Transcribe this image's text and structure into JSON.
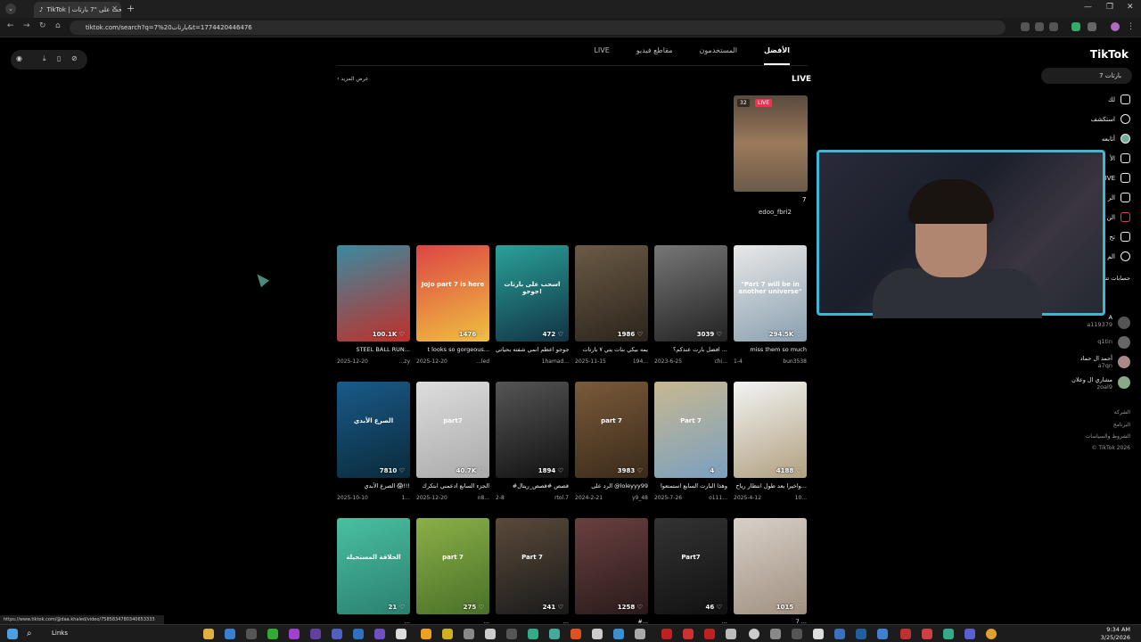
{
  "browser": {
    "tab_title": "TikTok | ابحث على \"7 بارتات\"",
    "url": "tiktok.com/search?q=7%20بارتات&t=1774420446476",
    "status_url": "https://www.tiktok.com/@daa.khaled/video/7585834780340653333"
  },
  "tiktok": {
    "logo": "TikTok",
    "search_value": "7 بارتات",
    "sidebar": [
      {
        "label": "لك",
        "icon": "home-icon"
      },
      {
        "label": "استكشف",
        "icon": "compass-icon"
      },
      {
        "label": "أتابعه",
        "icon": "avatar-icon"
      },
      {
        "label": "الأ",
        "icon": "friends-icon"
      },
      {
        "label": "LIVE",
        "icon": "live-icon"
      },
      {
        "label": "الر",
        "icon": "send-icon"
      },
      {
        "label": "الن",
        "icon": "inbox-icon"
      },
      {
        "label": "تح",
        "icon": "upload-icon"
      },
      {
        "label": "الم",
        "icon": "profile-icon"
      }
    ],
    "suggested_title": "حسابات تتابعها",
    "suggested": [
      {
        "name": "A",
        "handle": "a119379"
      },
      {
        "name": "",
        "handle": "q1tin"
      },
      {
        "name": "أحمد ال حماد",
        "handle": "a7qn"
      },
      {
        "name": "مشاري ال وعلان",
        "handle": "zoal9"
      }
    ],
    "footer": [
      "الشركة",
      "البرنامج",
      "الشروط والسياسات",
      "© TikTok 2026"
    ],
    "tabs": [
      "LIVE",
      "مقاطع فيديو",
      "المستخدمون",
      "الأفضل"
    ],
    "live_section": {
      "title": "LIVE",
      "see_more": "عرض المزيد",
      "badge": "LIVE",
      "viewers": "32",
      "caption": "7",
      "user": "edoo_fbri2"
    },
    "videos": [
      {
        "views": "294.5K",
        "overlay": "\"Part 7 will be in another universe\"",
        "desc": "miss them so much",
        "date": "1-4",
        "user": "bun3538",
        "color1": "#e8e8e8",
        "color2": "#8aa0b0"
      },
      {
        "views": "3039",
        "overlay": "",
        "desc": "افضل بارت عندكم؟ ...",
        "date": "2023-6-25",
        "user": "chi...",
        "color1": "#777",
        "color2": "#222"
      },
      {
        "views": "1986",
        "overlay": "",
        "desc": "يمه بيكي بنات يتي ٧ بارتات",
        "date": "2025-11-15",
        "user": "194...",
        "color1": "#6b5a45",
        "color2": "#2b241c"
      },
      {
        "views": "472",
        "overlay": "اسحب على بارتات جوجو!",
        "desc": "جوجو اعظم انمي شفته بحياتي",
        "date": "",
        "user": "1hamad...",
        "color1": "#2aa198",
        "color2": "#134"
      },
      {
        "views": "1476",
        "overlay": "JoJo part 7 is here",
        "desc": "t looks so gorgeous...",
        "date": "2025-12-20",
        "user": "...led",
        "color1": "#d44",
        "color2": "#f0c040"
      },
      {
        "views": "100.1K",
        "overlay": "",
        "desc": "STEEL BALL RUN...",
        "date": "2025-12-20",
        "user": "...zy",
        "color1": "#3a8aa0",
        "color2": "#c0302a"
      },
      {
        "views": "4188",
        "overlay": "",
        "desc": "واخيرا بعد طول انتظار رياح...",
        "date": "2025-4-12",
        "user": "10...",
        "color1": "#f4f4f4",
        "color2": "#b0a080"
      },
      {
        "views": "4",
        "overlay": "Part 7",
        "desc": "وهذا البارت السابع استمتعوا",
        "date": "2025-7-26",
        "user": "o111...",
        "color1": "#c8b890",
        "color2": "#7aa0c0"
      },
      {
        "views": "3983",
        "overlay": "part 7",
        "desc": "الرد على @loleyyy99",
        "date": "2024-2-21",
        "user": "y9_48",
        "color1": "#7a5a3a",
        "color2": "#3a2a1a"
      },
      {
        "views": "1894",
        "overlay": "",
        "desc": "#قصص #قصص_ريتال",
        "date": "2-8",
        "user": "rtol.7",
        "color1": "#555",
        "color2": "#111"
      },
      {
        "views": "40.7K",
        "overlay": "part7",
        "desc": "الجزء السابع ادعمني ابتكرك",
        "date": "2025-12-20",
        "user": "n8...",
        "color1": "#ddd",
        "color2": "#aaa"
      },
      {
        "views": "7810",
        "overlay": "الصرع الأبدي",
        "desc": "الصرع الأبدي 😱!!!",
        "date": "2025-10-10",
        "user": "1...",
        "color1": "#1a5a8a",
        "color2": "#0a2a3a"
      },
      {
        "views": "1015",
        "overlay": "",
        "desc": "7 ...",
        "date": "",
        "user": "",
        "color1": "#d8d0c8",
        "color2": "#a09080"
      },
      {
        "views": "46",
        "overlay": "Part7",
        "desc": "...",
        "date": "",
        "user": "",
        "color1": "#333",
        "color2": "#111"
      },
      {
        "views": "1258",
        "overlay": "",
        "desc": "#...",
        "date": "",
        "user": "",
        "color1": "#6a4040",
        "color2": "#2a1a1a"
      },
      {
        "views": "241",
        "overlay": "Part 7",
        "desc": "...",
        "date": "",
        "user": "",
        "color1": "#5a4a3a",
        "color2": "#1a1a1a"
      },
      {
        "views": "275",
        "overlay": "part 7",
        "desc": "...",
        "date": "",
        "user": "",
        "color1": "#8ab048",
        "color2": "#4a7028"
      },
      {
        "views": "21",
        "overlay": "الحلاقة المستحيلة",
        "desc": "...",
        "date": "",
        "user": "",
        "color1": "#4ac0a0",
        "color2": "#2a8070"
      }
    ]
  },
  "taskbar": {
    "search_label": "Links",
    "time": "9:34 AM",
    "date": "3/25/2026"
  }
}
